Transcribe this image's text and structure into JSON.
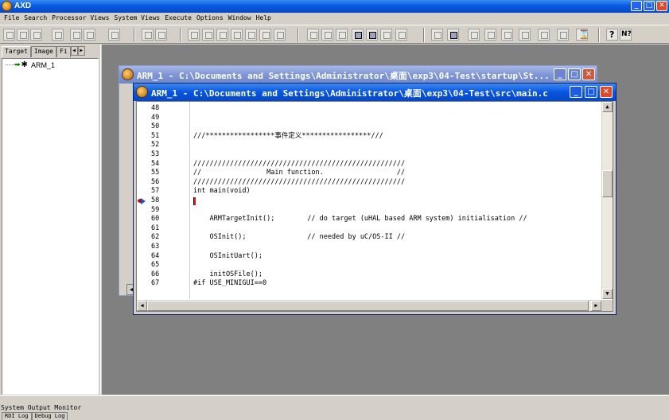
{
  "app": {
    "title": "AXD"
  },
  "menu": [
    "File",
    "Search",
    "Processor Views",
    "System Views",
    "Execute",
    "Options",
    "Window",
    "Help"
  ],
  "left_panel": {
    "tabs": [
      "Target",
      "Image",
      "Fi"
    ],
    "tree": {
      "label": "ARM_1"
    }
  },
  "back_window": {
    "title": "ARM_1 - C:\\Documents and Settings\\Administrator\\桌面\\exp3\\04-Test\\startup\\St..."
  },
  "front_window": {
    "title": "ARM_1 - C:\\Documents and Settings\\Administrator\\桌面\\exp3\\04-Test\\src\\main.c"
  },
  "source": {
    "breakpoint_line": "58",
    "lines": [
      {
        "n": "48",
        "text": ""
      },
      {
        "n": "49",
        "text": ""
      },
      {
        "n": "50",
        "text": ""
      },
      {
        "n": "51",
        "text": "///*****************事件定义*****************///"
      },
      {
        "n": "52",
        "text": ""
      },
      {
        "n": "53",
        "text": ""
      },
      {
        "n": "54",
        "text": "////////////////////////////////////////////////////"
      },
      {
        "n": "55",
        "text": "//                Main function.                  //"
      },
      {
        "n": "56",
        "text": "////////////////////////////////////////////////////"
      },
      {
        "n": "57",
        "text": "int main(void)"
      },
      {
        "n": "58",
        "text": ""
      },
      {
        "n": "59",
        "text": ""
      },
      {
        "n": "60",
        "text": "    ARMTargetInit();        // do target (uHAL based ARM system) initialisation //"
      },
      {
        "n": "61",
        "text": ""
      },
      {
        "n": "62",
        "text": "    OSInit();               // needed by uC/OS-II //"
      },
      {
        "n": "63",
        "text": ""
      },
      {
        "n": "64",
        "text": "    OSInitUart();"
      },
      {
        "n": "65",
        "text": ""
      },
      {
        "n": "66",
        "text": "    initOSFile();"
      },
      {
        "n": "67",
        "text": "#if USE_MINIGUI==0"
      }
    ]
  },
  "bottom_panel": {
    "title": "System Output Monitor",
    "tabs": [
      "RDI Log",
      "Debug Log"
    ]
  }
}
